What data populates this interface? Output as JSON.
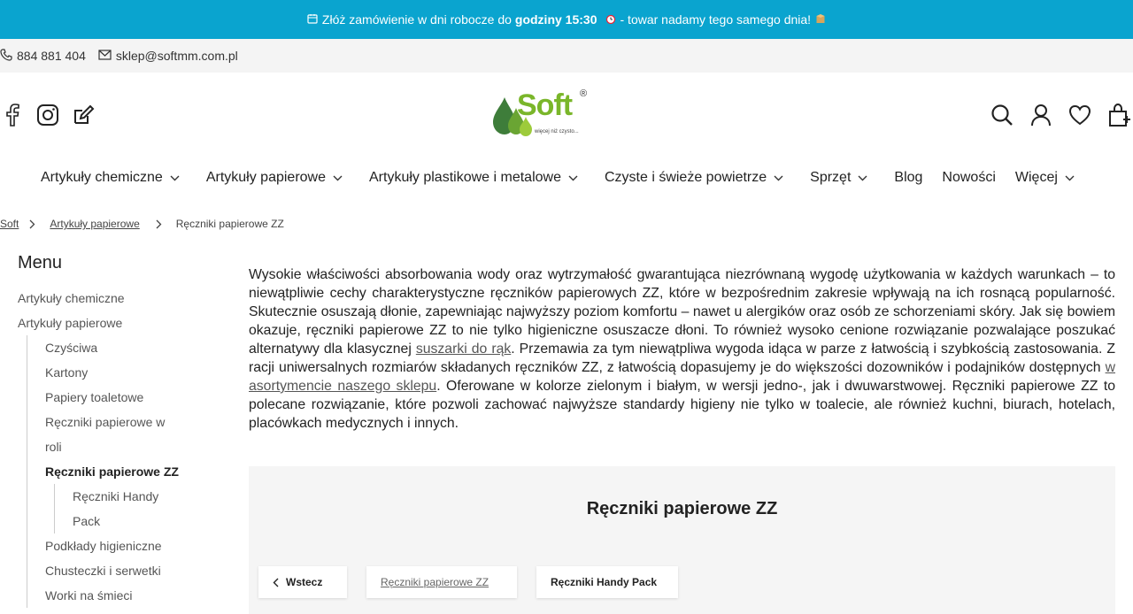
{
  "announcement": {
    "prefix": "Złóż zamówienie w dni robocze do",
    "bold": "godziny 15:30",
    "suffix": "- towar nadamy tego samego dnia!"
  },
  "contact": {
    "phone": "884 881 404",
    "email": "sklep@softmm.com.pl"
  },
  "logo": {
    "word": "Soft",
    "reg": "®",
    "tagline": "więcej niż czysto..."
  },
  "nav": [
    {
      "label": "Artykuły chemiczne",
      "dropdown": true
    },
    {
      "label": "Artykuły papierowe",
      "dropdown": true
    },
    {
      "label": "Artykuły plastikowe i metalowe",
      "dropdown": true
    },
    {
      "label": "Czyste i świeże powietrze",
      "dropdown": true
    },
    {
      "label": "Sprzęt",
      "dropdown": true
    },
    {
      "label": "Blog",
      "dropdown": false
    },
    {
      "label": "Nowości",
      "dropdown": false
    },
    {
      "label": "Więcej",
      "dropdown": true
    }
  ],
  "breadcrumb": {
    "home": "Soft",
    "parent": "Artykuły papierowe",
    "current": "Ręczniki papierowe ZZ"
  },
  "sidebar": {
    "title": "Menu",
    "top": [
      "Artykuły chemiczne",
      "Artykuły papierowe"
    ],
    "sub_before": [
      "Czyściwa",
      "Kartony",
      "Papiery toaletowe",
      "Ręczniki papierowe w roli"
    ],
    "active": "Ręczniki papierowe ZZ",
    "sub2": [
      "Ręczniki Handy Pack"
    ],
    "sub_after": [
      "Podkłady higieniczne",
      "Chusteczki i serwetki",
      "Worki na śmieci"
    ]
  },
  "content": {
    "p1": "Wysokie właściwości absorbowania wody oraz wytrzymałość gwarantująca niezrównaną wygodę użytkowania w każdych warunkach – to niewątpliwie cechy charakterystyczne ręczników papierowych ZZ, które w bezpośrednim zakresie wpływają na ich rosnącą popularność. Skutecznie osuszają dłonie, zapewniając najwyższy poziom komfortu – nawet u alergików oraz osób ze schorzeniami skóry. Jak się bowiem okazuje, ręczniki papierowe ZZ to nie tylko higieniczne osuszacze dłoni. To również wysoko cenione rozwiązanie pozwalające poszukać alternatywy dla klasycznej",
    "link1": "suszarki do rąk",
    "p2": ". Przemawia za tym niewątpliwa wygoda idąca w parze z łatwością i szybkością zastosowania. Z racji uniwersalnych rozmiarów składanych ręczników ZZ, z łatwością dopasujemy je do większości dozowników i podajników dostępnych",
    "link2": "w asortymencie naszego sklepu",
    "p3": ". Oferowane w kolorze zielonym i białym, w wersji jedno-, jak i dwuwarstwowej. Ręczniki papierowe ZZ to polecane rozwiązanie, które pozwoli zachować najwyższe standardy higieny nie tylko w toalecie, ale również kuchni, biurach, hotelach, placówkach medycznych i innych."
  },
  "panel": {
    "title": "Ręczniki papierowe ZZ",
    "back": "Wstecz",
    "current_link": "Ręczniki papierowe ZZ",
    "child": "Ręczniki Handy Pack"
  },
  "colors": {
    "announcement_bg": "#0aa4cf",
    "brand_green": "#7ab62a",
    "contact_bg": "#f4f4f4"
  }
}
